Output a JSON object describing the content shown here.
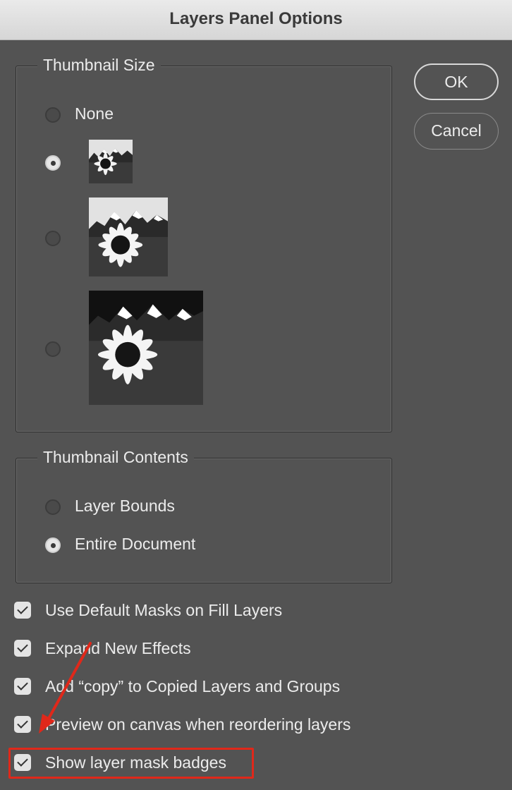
{
  "window": {
    "title": "Layers Panel Options"
  },
  "thumbnail_size": {
    "legend": "Thumbnail Size",
    "options": [
      {
        "label": "None",
        "selected": false
      },
      {
        "label": "",
        "size": "small",
        "selected": true
      },
      {
        "label": "",
        "size": "medium",
        "selected": false
      },
      {
        "label": "",
        "size": "large",
        "selected": false
      }
    ]
  },
  "thumbnail_contents": {
    "legend": "Thumbnail Contents",
    "options": [
      {
        "label": "Layer Bounds",
        "selected": false
      },
      {
        "label": "Entire Document",
        "selected": true
      }
    ]
  },
  "buttons": {
    "ok": "OK",
    "cancel": "Cancel"
  },
  "checkboxes": [
    {
      "label": "Use Default Masks on Fill Layers",
      "checked": true
    },
    {
      "label": "Expand New Effects",
      "checked": true
    },
    {
      "label": "Add “copy” to Copied Layers and Groups",
      "checked": true
    },
    {
      "label": "Preview on canvas when reordering layers",
      "checked": true
    },
    {
      "label": "Show layer mask badges",
      "checked": true
    }
  ],
  "colors": {
    "panel_bg": "#535353",
    "annotation": "#e0281a"
  }
}
